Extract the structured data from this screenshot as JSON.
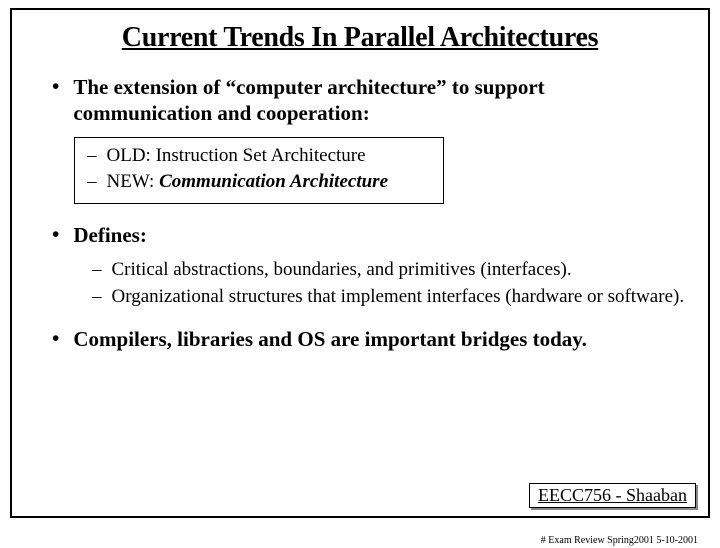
{
  "title": "Current Trends In Parallel Architectures",
  "bullets": {
    "b1": "The extension of “computer architecture” to support communication and cooperation:",
    "b1_sub1_prefix": "OLD:  ",
    "b1_sub1_text": "Instruction Set Architecture",
    "b1_sub2_prefix": "NEW: ",
    "b1_sub2_text": "Communication Architecture",
    "b2": "Defines:",
    "b2_sub1": "Critical abstractions, boundaries, and primitives (interfaces).",
    "b2_sub2": "Organizational structures that implement interfaces (hardware or software).",
    "b3": "Compilers, libraries and OS are important bridges today."
  },
  "footer": {
    "course": "EECC756 - Shaaban",
    "meta": "#   Exam Review   Spring2001  5-10-2001"
  }
}
